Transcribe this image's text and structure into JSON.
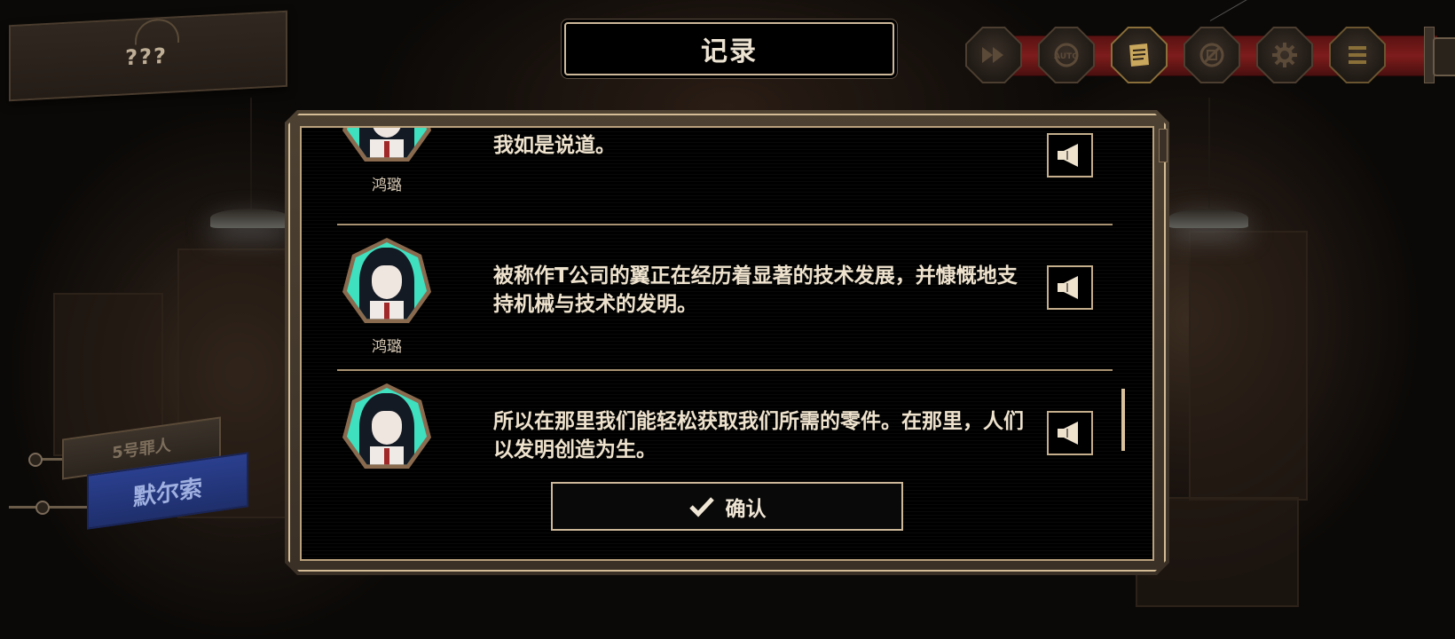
{
  "speaker_plate": {
    "name": "???"
  },
  "log_title": "记录",
  "toolbar": {
    "buttons": [
      {
        "name": "fast-forward",
        "icon": "fast-forward-icon",
        "active": false
      },
      {
        "name": "auto",
        "icon": "auto-icon",
        "active": false
      },
      {
        "name": "log",
        "icon": "log-icon",
        "active": true
      },
      {
        "name": "hide-ui",
        "icon": "hide-ui-icon",
        "active": false
      },
      {
        "name": "settings",
        "icon": "gear-icon",
        "active": false
      },
      {
        "name": "menu",
        "icon": "menu-icon",
        "active": false
      }
    ],
    "rail_color": "#7e1c1c"
  },
  "side_tags": {
    "sinner_number": "5号罪人",
    "sinner_name": "默尔索"
  },
  "log_entries": [
    {
      "speaker": "鸿璐",
      "text": "我如是说道。",
      "voice_icon": "speaker-icon"
    },
    {
      "speaker": "鸿璐",
      "text": "被称作T公司的翼正在经历着显著的技术发展，并慷慨地支持机械与技术的发明。",
      "voice_icon": "speaker-icon"
    },
    {
      "speaker": "",
      "text": "所以在那里我们能轻松获取我们所需的零件。在那里，人们以发明创造为生。",
      "voice_icon": "speaker-icon"
    }
  ],
  "confirm_button": {
    "label": "确认",
    "icon": "checkmark-icon"
  },
  "colors": {
    "frame_gold": "#d4bc96",
    "avatar_bg": "#3ee0c0",
    "name_tag_blue": "#2a3f8e"
  }
}
